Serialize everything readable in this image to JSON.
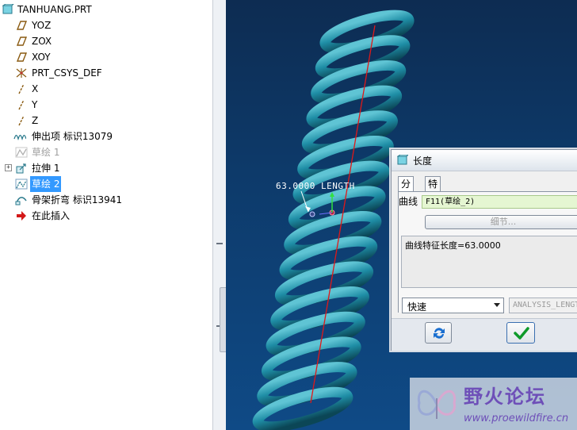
{
  "tree": {
    "root": "TANHUANG.PRT",
    "items": [
      {
        "label": "YOZ",
        "icon": "datum-plane-icon"
      },
      {
        "label": "ZOX",
        "icon": "datum-plane-icon"
      },
      {
        "label": "XOY",
        "icon": "datum-plane-icon"
      },
      {
        "label": "PRT_CSYS_DEF",
        "icon": "coordinate-system-icon"
      },
      {
        "label": "X",
        "icon": "datum-axis-icon"
      },
      {
        "label": "Y",
        "icon": "datum-axis-icon"
      },
      {
        "label": "Z",
        "icon": "datum-axis-icon"
      },
      {
        "label": "伸出项 标识13079",
        "icon": "protrusion-icon"
      },
      {
        "label": "草绘 1",
        "icon": "sketch-icon",
        "state": "suppressed"
      },
      {
        "label": "拉伸 1",
        "icon": "extrude-icon",
        "expandable": true
      },
      {
        "label": "草绘 2",
        "icon": "sketch-icon",
        "state": "selected"
      },
      {
        "label": "骨架折弯 标识13941",
        "icon": "spinal-bend-icon"
      },
      {
        "label": "在此插入",
        "icon": "insert-here-arrow-icon"
      }
    ]
  },
  "viewport": {
    "annotation": "63.0000 LENGTH",
    "colors": {
      "spring": "#1f8ea6",
      "curve": "#e01818",
      "background": "#0f4a86"
    }
  },
  "dialog": {
    "title": "长度",
    "tabs": [
      "分析",
      "特征"
    ],
    "curve_label": "曲线",
    "curve_value": "F11(草绘_2)",
    "details_button": "细节...",
    "result": "曲线特征长度=63.0000",
    "mode_select": "快速",
    "analysis_name": "ANALYSIS_LENGTH",
    "colors": {
      "curve_field": "#e5f6d2",
      "selected_tab": "#ffffff"
    }
  },
  "watermark": {
    "title": "野火论坛",
    "url": "www.proewildfire.cn"
  }
}
